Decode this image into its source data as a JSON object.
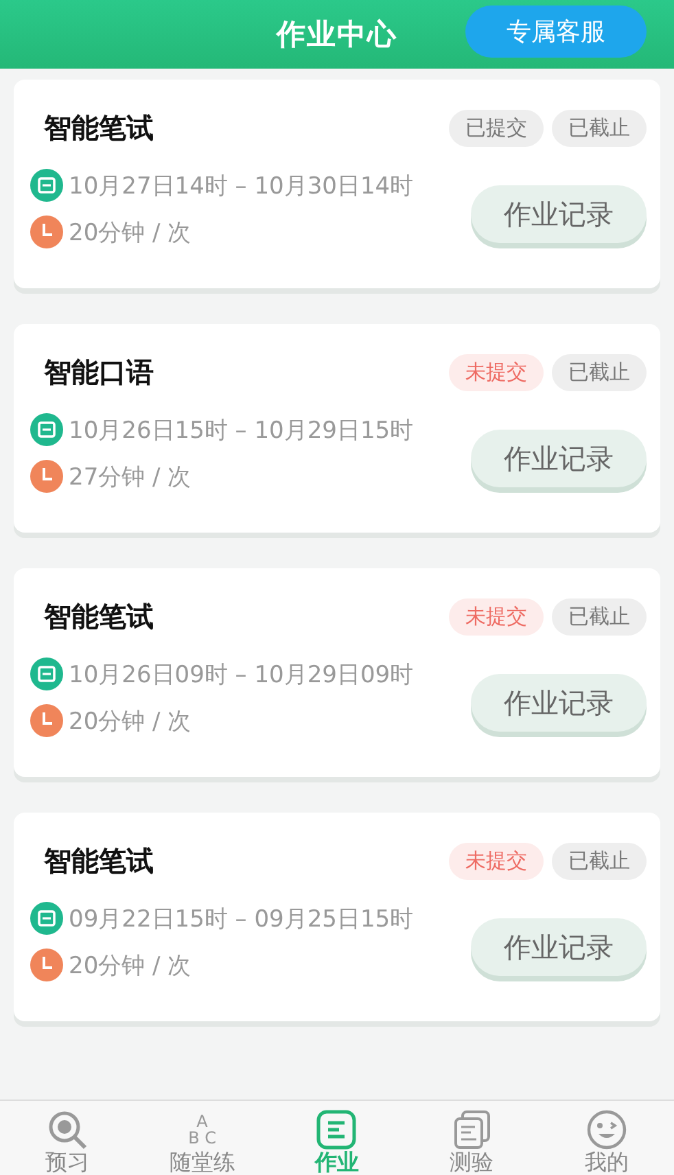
{
  "header": {
    "title": "作业中心",
    "service_button": "专属客服"
  },
  "assignments": [
    {
      "title": "智能笔试",
      "submit_status": {
        "label": "已提交",
        "submitted": true
      },
      "deadline_status": "已截止",
      "time_range": "10月27日14时 – 10月30日14时",
      "duration": "20分钟 / 次",
      "record_button": "作业记录"
    },
    {
      "title": "智能口语",
      "submit_status": {
        "label": "未提交",
        "submitted": false
      },
      "deadline_status": "已截止",
      "time_range": "10月26日15时 – 10月29日15时",
      "duration": "27分钟 / 次",
      "record_button": "作业记录"
    },
    {
      "title": "智能笔试",
      "submit_status": {
        "label": "未提交",
        "submitted": false
      },
      "deadline_status": "已截止",
      "time_range": "10月26日09时 – 10月29日09时",
      "duration": "20分钟 / 次",
      "record_button": "作业记录"
    },
    {
      "title": "智能笔试",
      "submit_status": {
        "label": "未提交",
        "submitted": false
      },
      "deadline_status": "已截止",
      "time_range": "09月22日15时 – 09月25日15时",
      "duration": "20分钟 / 次",
      "record_button": "作业记录"
    }
  ],
  "tab_bar": [
    {
      "label": "预习",
      "kind": "search",
      "selected": false
    },
    {
      "label": "随堂练",
      "kind": "letters",
      "icon_text": [
        "A",
        "B C"
      ],
      "selected": false
    },
    {
      "label": "作业",
      "kind": "list",
      "selected": true
    },
    {
      "label": "测验",
      "kind": "papers",
      "selected": false
    },
    {
      "label": "我的",
      "kind": "face",
      "selected": false
    }
  ]
}
